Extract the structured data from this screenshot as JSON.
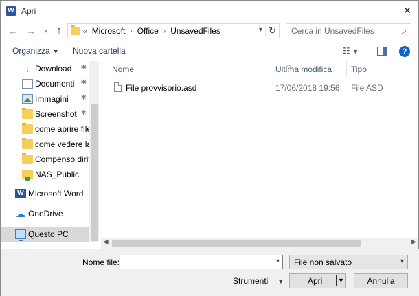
{
  "window": {
    "title": "Apri",
    "app_icon": "word-icon"
  },
  "address_bar": {
    "prefix": "«",
    "crumbs": [
      "Microsoft",
      "Office",
      "UnsavedFiles"
    ]
  },
  "search": {
    "placeholder": "Cerca in UnsavedFiles"
  },
  "toolbar": {
    "organize_label": "Organizza",
    "new_folder_label": "Nuova cartella"
  },
  "nav_pane": {
    "items": [
      {
        "label": "Download",
        "icon": "download-icon",
        "pinned": true
      },
      {
        "label": "Documenti",
        "icon": "documents-icon",
        "pinned": true
      },
      {
        "label": "Immagini",
        "icon": "pictures-icon",
        "pinned": true
      },
      {
        "label": "Screenshot",
        "icon": "folder-icon",
        "pinned": true
      },
      {
        "label": "come aprire file",
        "icon": "folder-icon",
        "pinned": false
      },
      {
        "label": "come vedere la r",
        "icon": "folder-icon",
        "pinned": false
      },
      {
        "label": "Compenso diritti",
        "icon": "folder-icon",
        "pinned": false
      },
      {
        "label": "NAS_Public",
        "icon": "network-folder-icon",
        "pinned": false
      }
    ],
    "roots": [
      {
        "label": "Microsoft Word",
        "icon": "word-icon"
      },
      {
        "label": "OneDrive",
        "icon": "onedrive-icon"
      },
      {
        "label": "Questo PC",
        "icon": "this-pc-icon",
        "selected": true
      }
    ]
  },
  "file_list": {
    "columns": [
      "Nome",
      "Ultima modifica",
      "Tipo"
    ],
    "rows": [
      {
        "name": "File provvisorio.asd",
        "modified": "17/06/2018 19:56",
        "type": "File ASD"
      }
    ]
  },
  "footer": {
    "filename_label": "Nome file:",
    "filename_value": "",
    "filetype_value": "File non salvato",
    "tools_label": "Strumenti",
    "open_label": "Apri",
    "cancel_label": "Annulla"
  }
}
